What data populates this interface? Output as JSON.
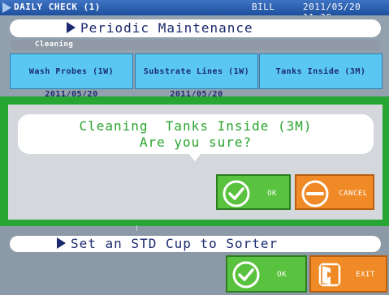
{
  "titlebar": {
    "title": "DAILY CHECK (1)",
    "user": "BILL",
    "datetime": "2011/05/20 11:39"
  },
  "main": {
    "heading": "Periodic Maintenance",
    "section_label": "Cleaning",
    "buttons": [
      {
        "label": "Wash Probes (1W)",
        "date": "2011/05/20"
      },
      {
        "label": "Substrate Lines (1W)",
        "date": "2011/05/20"
      },
      {
        "label": "Tanks Inside (3M)"
      }
    ]
  },
  "dialog": {
    "line1": "Cleaning  Tanks Inside (3M)",
    "line2": "Are you sure?",
    "ok_label": "OK",
    "cancel_label": "CANCEL"
  },
  "footer": {
    "instruction": "Set an STD Cup to Sorter",
    "ok_label": "OK",
    "exit_label": "EXIT"
  },
  "colors": {
    "titlebar": "#1d4f9c",
    "dialog_frame": "#27a634",
    "ok": "#59c23e",
    "cancel": "#f08a26",
    "task_button": "#59c7f2"
  }
}
